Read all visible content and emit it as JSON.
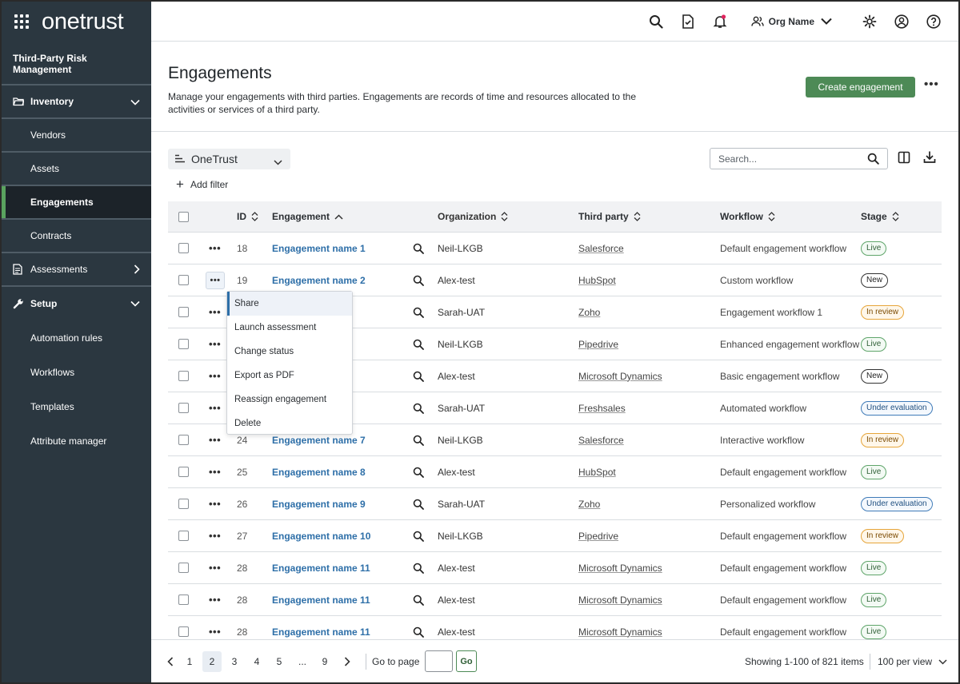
{
  "brand": {
    "name": "onetrust"
  },
  "module_title": "Third-Party Risk Management",
  "sidebar": {
    "inventory": "Inventory",
    "vendors": "Vendors",
    "assets": "Assets",
    "engagements": "Engagements",
    "contracts": "Contracts",
    "assessments": "Assessments",
    "setup": "Setup",
    "automation_rules": "Automation rules",
    "workflows": "Workflows",
    "templates": "Templates",
    "attribute_manager": "Attribute manager"
  },
  "topbar": {
    "org_name": "Org Name"
  },
  "header": {
    "title": "Engagements",
    "description": "Manage your engagements with third parties. Engagements are records of time and resources allocated to the activities or services of a third party.",
    "create_button": "Create engagement"
  },
  "toolbar": {
    "scope": "OneTrust",
    "add_filter": "Add filter",
    "search_placeholder": "Search..."
  },
  "table": {
    "columns": {
      "id": "ID",
      "engagement": "Engagement",
      "organization": "Organization",
      "third_party": "Third party",
      "workflow": "Workflow",
      "stage": "Stage"
    },
    "rows": [
      {
        "id": "18",
        "engagement": "Engagement name 1",
        "organization": "Neil-LKGB",
        "third_party": "Salesforce",
        "workflow": "Default engagement workflow",
        "stage": "Live"
      },
      {
        "id": "19",
        "engagement": "Engagement name 2",
        "organization": "Alex-test",
        "third_party": "HubSpot",
        "workflow": "Custom workflow",
        "stage": "New"
      },
      {
        "id": "",
        "engagement": "e 3",
        "organization": "Sarah-UAT",
        "third_party": "Zoho",
        "workflow": "Engagement workflow 1",
        "stage": "In review"
      },
      {
        "id": "",
        "engagement": "e 4",
        "organization": "Neil-LKGB",
        "third_party": "Pipedrive",
        "workflow": "Enhanced engagement workflow",
        "stage": "Live"
      },
      {
        "id": "",
        "engagement": "e 5",
        "organization": "Alex-test",
        "third_party": "Microsoft Dynamics",
        "workflow": "Basic engagement workflow",
        "stage": "New"
      },
      {
        "id": "",
        "engagement": "e 6",
        "organization": "Sarah-UAT",
        "third_party": "Freshsales",
        "workflow": "Automated  workflow",
        "stage": "Under evaluation"
      },
      {
        "id": "24",
        "engagement": "Engagement name 7",
        "organization": "Neil-LKGB",
        "third_party": "Salesforce",
        "workflow": "Interactive  workflow",
        "stage": "In review"
      },
      {
        "id": "25",
        "engagement": "Engagement name 8",
        "organization": "Alex-test",
        "third_party": "HubSpot",
        "workflow": "Default engagement workflow",
        "stage": "Live"
      },
      {
        "id": "26",
        "engagement": "Engagement name 9",
        "organization": "Sarah-UAT",
        "third_party": "Zoho",
        "workflow": "Personalized  workflow",
        "stage": "Under evaluation"
      },
      {
        "id": "27",
        "engagement": "Engagement name 10",
        "organization": "Neil-LKGB",
        "third_party": "Pipedrive",
        "workflow": "Default engagement workflow",
        "stage": "In review"
      },
      {
        "id": "28",
        "engagement": "Engagement name 11",
        "organization": "Alex-test",
        "third_party": "Microsoft Dynamics",
        "workflow": "Default engagement workflow",
        "stage": "Live"
      },
      {
        "id": "28",
        "engagement": "Engagement name 11",
        "organization": "Alex-test",
        "third_party": "Microsoft Dynamics",
        "workflow": "Default engagement workflow",
        "stage": "Live"
      },
      {
        "id": "28",
        "engagement": "Engagement name 11",
        "organization": "Alex-test",
        "third_party": "Microsoft Dynamics",
        "workflow": "Default engagement workflow",
        "stage": "Live"
      }
    ]
  },
  "context_menu": {
    "items": [
      "Share",
      "Launch assessment",
      "Change status",
      "Export as PDF",
      "Reassign engagement",
      "Delete"
    ]
  },
  "pagination": {
    "pages": [
      "1",
      "2",
      "3",
      "4",
      "5",
      "...",
      "9"
    ],
    "current": "2",
    "go_to_label": "Go to page",
    "go_button": "Go",
    "showing": "Showing 1-100 of 821 items",
    "per_view": "100 per view"
  },
  "colors": {
    "sidebar_bg": "#2b3740",
    "accent_green": "#4d8a56",
    "link_blue": "#2e6fa8"
  }
}
